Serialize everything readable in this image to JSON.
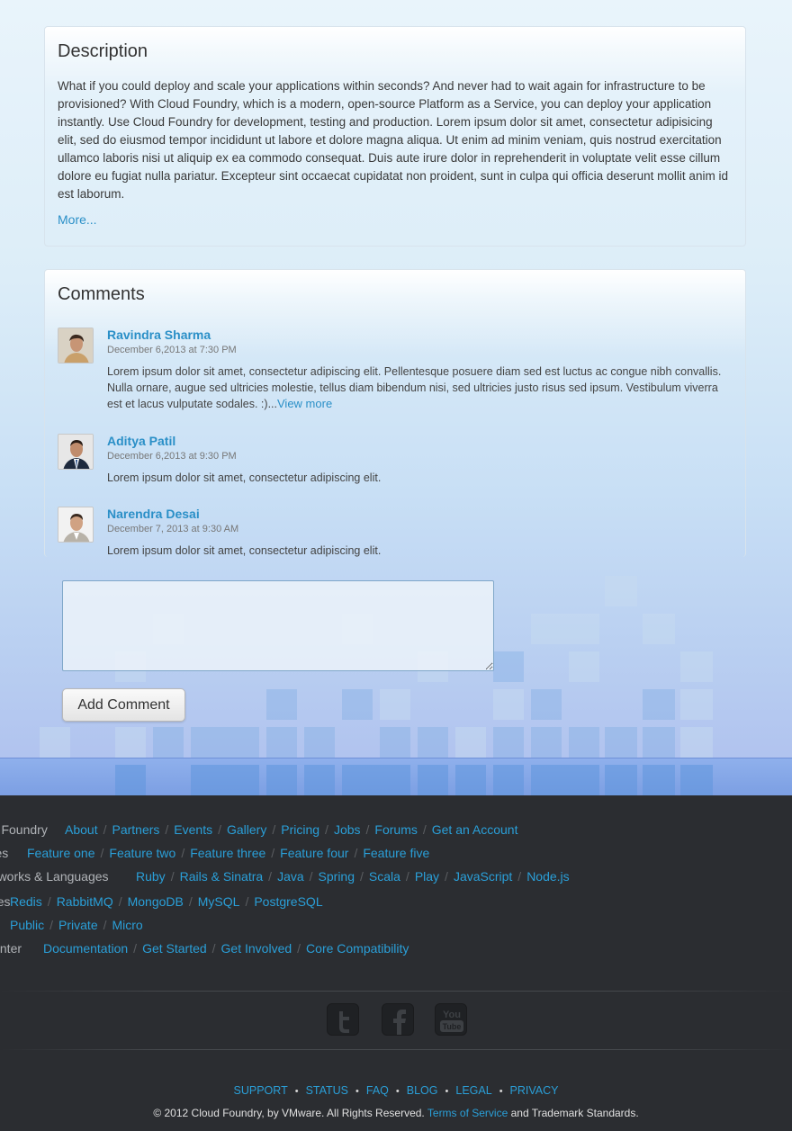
{
  "description": {
    "title": "Description",
    "text": "What if you could deploy and scale your applications within seconds? And never had to wait again for infrastructure to be provisioned? With Cloud Foundry, which is a modern, open-source Platform as a Service, you can deploy your application instantly. Use Cloud Foundry for development, testing and production. Lorem ipsum dolor sit amet, consectetur adipisicing elit, sed do eiusmod tempor incididunt ut labore et dolore magna aliqua. Ut enim ad minim veniam, quis nostrud exercitation ullamco laboris nisi ut aliquip ex ea commodo consequat. Duis aute irure dolor in reprehenderit in voluptate velit esse cillum dolore eu fugiat nulla pariatur. Excepteur sint occaecat cupidatat non proident, sunt in culpa qui officia deserunt mollit anim id est laborum.",
    "more_label": "More..."
  },
  "comments": {
    "title": "Comments",
    "items": [
      {
        "author": "Ravindra Sharma",
        "date": "December 6,2013 at 7:30 PM",
        "text": "Lorem ipsum dolor sit amet, consectetur adipiscing elit. Pellentesque posuere diam sed est luctus ac congue nibh convallis. Nulla ornare, augue sed ultricies molestie, tellus diam bibendum nisi, sed ultricies justo risus sed ipsum. Vestibulum viverra est et lacus vulputate sodales. :)...",
        "view_more": "View more"
      },
      {
        "author": "Aditya Patil",
        "date": "December 6,2013 at 9:30 PM",
        "text": "Lorem ipsum dolor sit amet, consectetur adipiscing elit."
      },
      {
        "author": "Narendra Desai",
        "date": "December 7, 2013 at 9:30 AM",
        "text": "Lorem ipsum dolor sit amet, consectetur adipiscing elit."
      }
    ],
    "input_value": "",
    "add_label": "Add Comment"
  },
  "footer": {
    "rows": [
      {
        "label": "ud Foundry",
        "links": [
          "About",
          "Partners",
          "Events",
          "Gallery",
          "Pricing",
          "Jobs",
          "Forums",
          "Get an Account"
        ]
      },
      {
        "label": "ures",
        "links": [
          "Feature one",
          "Feature two",
          "Feature three",
          "Feature four",
          "Feature five"
        ]
      },
      {
        "label": "neworks & Languages",
        "links": [
          "Ruby",
          "Rails & Sinatra",
          "Java",
          "Spring",
          "Scala",
          "Play",
          "JavaScript",
          "Node.js"
        ]
      },
      {
        "label": "rices",
        "links": [
          "Redis",
          "RabbitMQ",
          "MongoDB",
          "MySQL",
          "PostgreSQL"
        ]
      },
      {
        "label": "ud",
        "links": [
          "Public",
          "Private",
          "Micro"
        ]
      },
      {
        "label": "Center",
        "links": [
          "Documentation",
          "Get Started",
          "Get Involved",
          "Core Compatibility"
        ]
      }
    ],
    "social": [
      {
        "icon": "twitter-icon",
        "glyph": "t"
      },
      {
        "icon": "facebook-icon",
        "glyph": "f"
      },
      {
        "icon": "youtube-icon",
        "glyph": "You Tube"
      }
    ],
    "bottom_links": [
      "SUPPORT",
      "STATUS",
      "FAQ",
      "BLOG",
      "LEGAL",
      "PRIVACY"
    ],
    "copyright_prefix": "© 2012 Cloud Foundry, by VMware. All Rights Reserved.",
    "terms_label": "Terms of Service",
    "copyright_suffix": "and Trademark Standards."
  },
  "colors": {
    "link": "#2a8fc7",
    "footer_link": "#2a9fd8",
    "footer_bg": "#2b2d31"
  }
}
